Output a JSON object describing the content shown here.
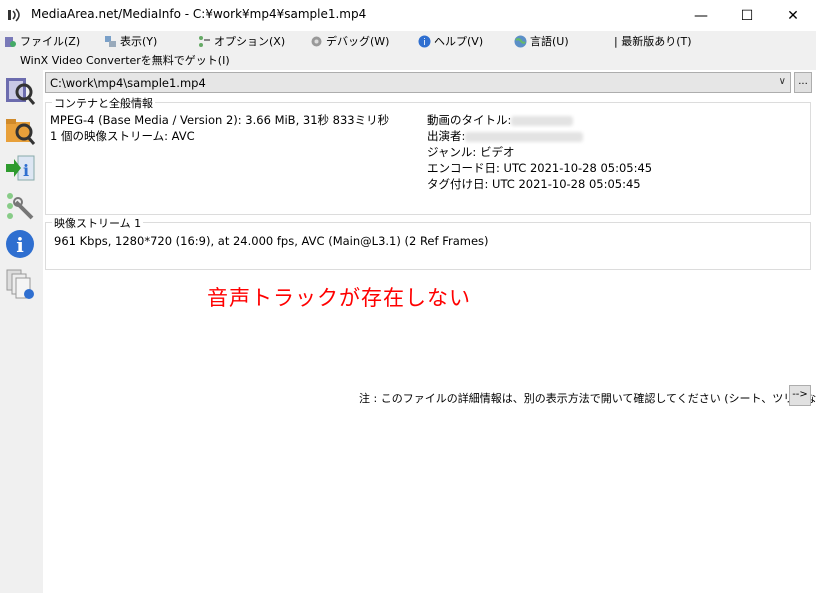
{
  "window": {
    "title": "MediaArea.net/MediaInfo - C:¥work¥mp4¥sample1.mp4",
    "minimize_glyph": "—",
    "maximize_glyph": "☐",
    "close_glyph": "✕"
  },
  "menu": {
    "file": "ファイル(Z)",
    "view": "表示(Y)",
    "options": "オプション(X)",
    "debug": "デバッグ(W)",
    "help": "ヘルプ(V)",
    "language": "言語(U)",
    "newest": "| 最新版あり(T)"
  },
  "promo": "WinX Video Converterを無料でゲット(I)",
  "file_combo": {
    "value": "C:\\work\\mp4\\sample1.mp4",
    "dropdown_glyph": "∨",
    "browse_label": "..."
  },
  "general": {
    "legend": "コンテナと全般情報",
    "format_line": "MPEG-4 (Base Media / Version 2): 3.66 MiB, 31秒 833ミリ秒",
    "streams_line": "1 個の映像ストリーム: AVC",
    "movie_title_label": "動画のタイトル:",
    "performer_label": "出演者:",
    "genre": "ジャンル: ビデオ",
    "encoded_date": "エンコード日: UTC 2021-10-28 05:05:45",
    "tagged_date": "タグ付け日: UTC 2021-10-28 05:05:45"
  },
  "video": {
    "legend": "映像ストリーム 1",
    "details": "961 Kbps, 1280*720 (16:9), at 24.000 fps, AVC (Main@L3.1) (2 Ref Frames)"
  },
  "annotation": "音声トラックが存在しない",
  "note": "注 : このファイルの詳細情報は、別の表示方法で開いて確認してください (シート、ツリーなど)",
  "next_button": "-->",
  "colors": {
    "annotation": "#ff0000",
    "sidebar_bg": "#f0f0f0",
    "content_bg": "#ffffff"
  }
}
